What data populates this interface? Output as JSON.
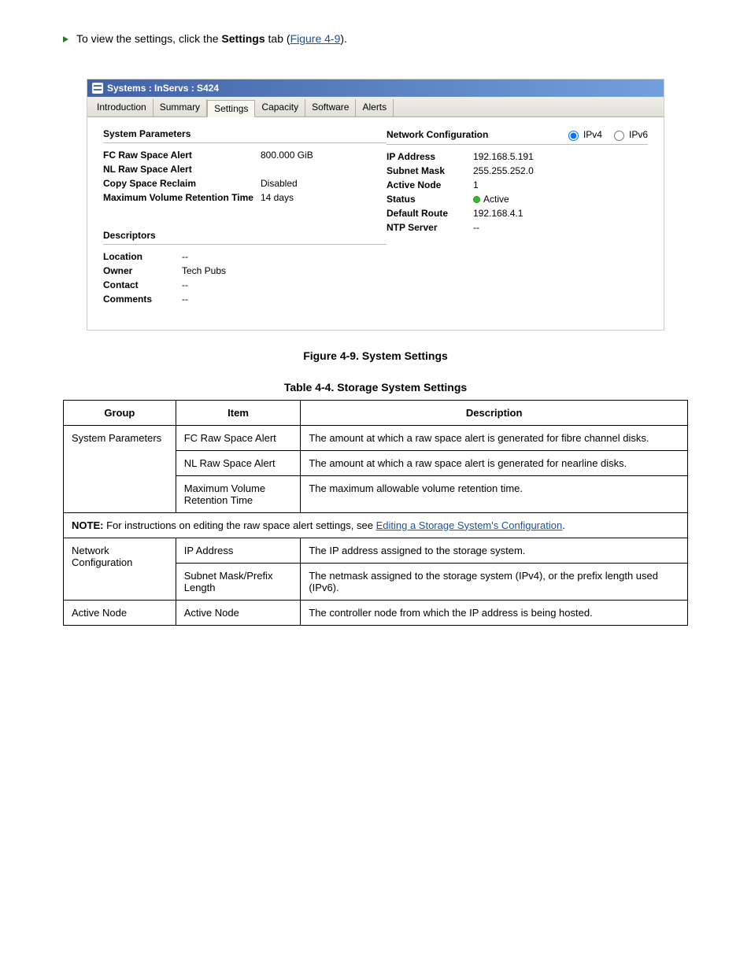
{
  "instruction": {
    "text_prefix": "To view the settings, click the ",
    "strong": "Settings",
    "text_mid": " tab (",
    "link_text": "Figure 4-9",
    "text_end": ")."
  },
  "titlebar": "Systems : InServs : S424",
  "tabs": [
    {
      "label": "Introduction",
      "active": false
    },
    {
      "label": "Summary",
      "active": false
    },
    {
      "label": "Settings",
      "active": true
    },
    {
      "label": "Capacity",
      "active": false
    },
    {
      "label": "Software",
      "active": false
    },
    {
      "label": "Alerts",
      "active": false
    }
  ],
  "sys_params": {
    "title": "System Parameters",
    "items": [
      {
        "label": "FC Raw Space Alert",
        "value": "800.000 GiB"
      },
      {
        "label": "NL Raw Space Alert",
        "value": "<disabled>"
      },
      {
        "label": "Copy Space Reclaim",
        "value": "Disabled"
      },
      {
        "label": "Maximum Volume Retention Time",
        "value": "14 days"
      }
    ]
  },
  "net_config": {
    "title": "Network Configuration",
    "radios": {
      "ipv4": "IPv4",
      "ipv6": "IPv6"
    },
    "items": [
      {
        "label": "IP Address",
        "value": "192.168.5.191"
      },
      {
        "label": "Subnet Mask",
        "value": "255.255.252.0"
      },
      {
        "label": "Active Node",
        "value": "1"
      },
      {
        "label": "Status",
        "value": "Active",
        "status": true
      },
      {
        "label": "Default Route",
        "value": "192.168.4.1"
      },
      {
        "label": "NTP Server",
        "value": "--"
      }
    ]
  },
  "descriptors": {
    "title": "Descriptors",
    "items": [
      {
        "label": "Location",
        "value": "--"
      },
      {
        "label": "Owner",
        "value": "Tech Pubs"
      },
      {
        "label": "Contact",
        "value": "--"
      },
      {
        "label": "Comments",
        "value": "--"
      }
    ]
  },
  "figure_caption": "Figure 4-9.  System Settings",
  "table": {
    "caption": "Table 4-4.  Storage System Settings",
    "headers": [
      "Group",
      "Item",
      "Description"
    ],
    "group1": {
      "name": "System Parameters",
      "rows": [
        {
          "item": "FC Raw Space Alert",
          "desc": "The amount at which a raw space alert is generated for fibre channel disks."
        },
        {
          "item": "NL Raw Space Alert",
          "desc": "The amount at which a raw space alert is generated for nearline disks."
        },
        {
          "item": "Maximum Volume Retention Time",
          "desc": "The maximum allowable volume retention time."
        }
      ]
    },
    "note": {
      "label": "NOTE: ",
      "text_prefix": "For instructions on editing the raw space alert settings, see ",
      "link": "Editing a Storage System's Configuration",
      "text_end": "."
    },
    "group2": {
      "name": "Network Configuration",
      "rows": [
        {
          "item": "IP Address",
          "desc": "The IP address assigned to the storage system."
        },
        {
          "item": "Subnet Mask/Prefix Length",
          "desc": "The netmask assigned to the storage system (IPv4), or the prefix length used (IPv6)."
        }
      ]
    },
    "group3": {
      "name": "Active Node",
      "rows": [
        {
          "item": "Active Node",
          "desc": "The controller node from which the IP address is being hosted."
        }
      ]
    }
  }
}
